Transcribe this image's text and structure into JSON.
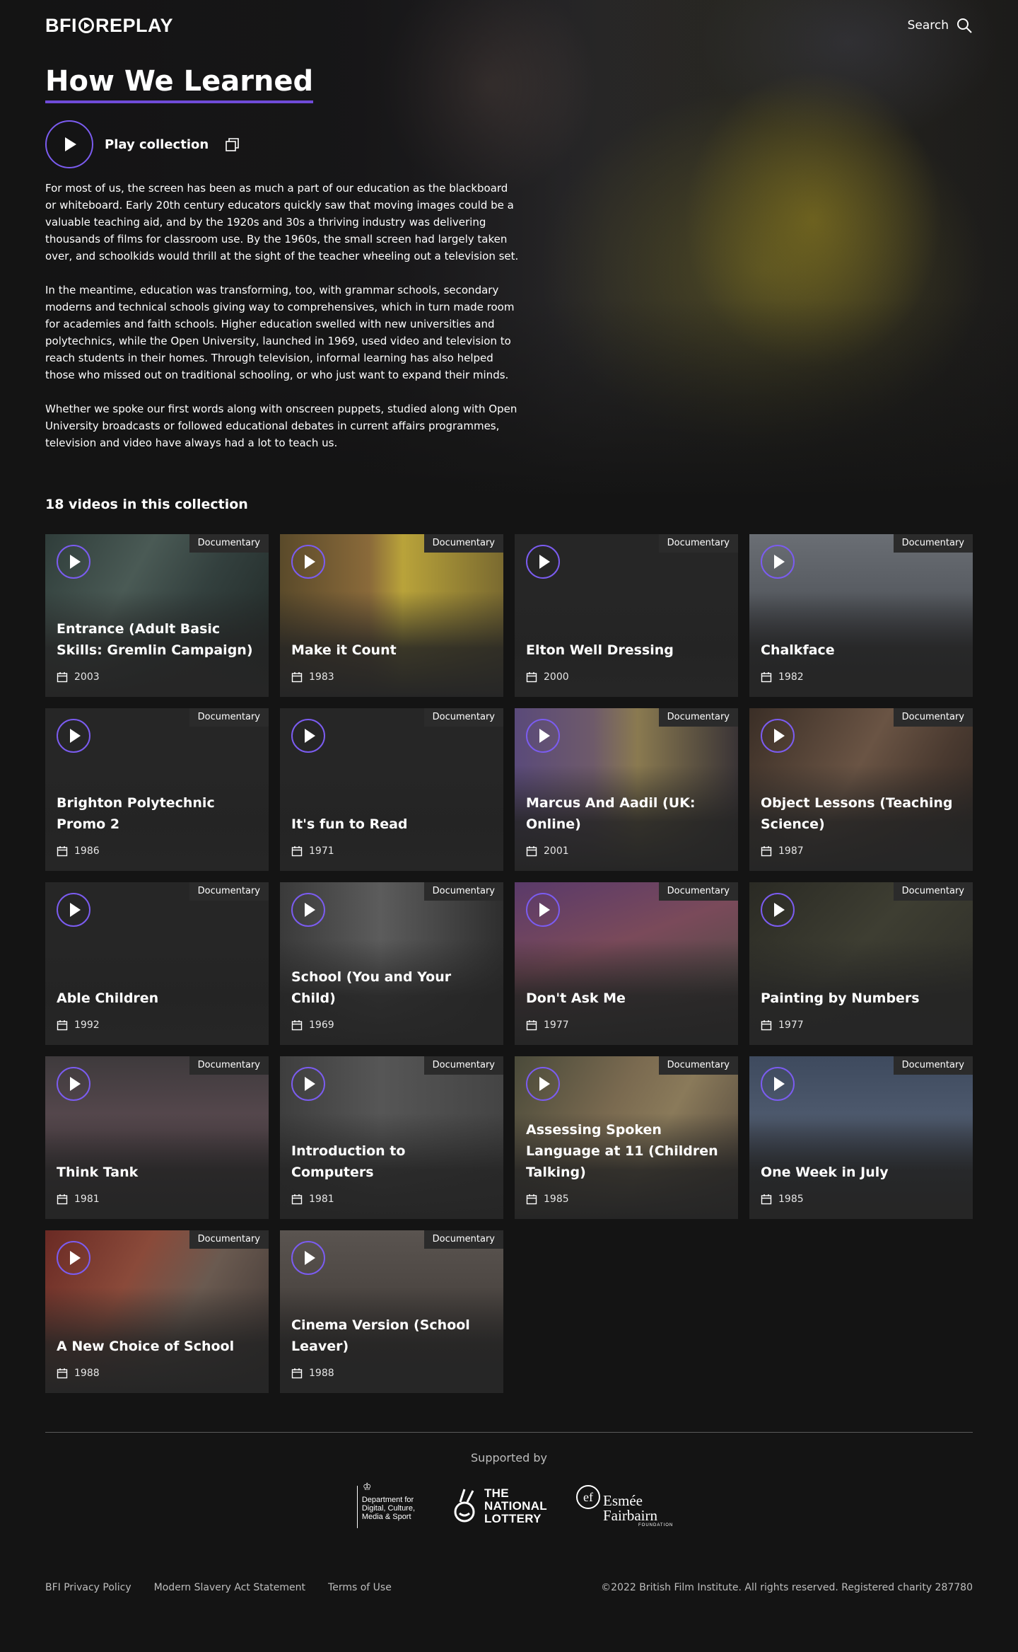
{
  "header": {
    "logo_left": "BFI",
    "logo_right": "REPLAY",
    "search_label": "Search"
  },
  "hero": {
    "title": "How We Learned",
    "play_label": "Play collection",
    "paragraphs": [
      "For most of us, the screen has been as much a part of our education as the blackboard or whiteboard. Early 20th century educators quickly saw that moving images could be a valuable teaching aid, and by the 1920s and 30s a thriving industry was delivering thousands of films for classroom use. By the 1960s, the small screen had largely taken over, and schoolkids would thrill at the sight of the teacher wheeling out a television set.",
      "In the meantime, education was transforming, too, with grammar schools, secondary moderns and technical schools giving way to comprehensives, which in turn made room for academies and faith schools. Higher education swelled with new universities and polytechnics, while the Open University, launched in 1969, used video and television to reach students in their homes. Through television, informal learning has also helped those who missed out on traditional schooling, or who just want to expand their minds.",
      "Whether we spoke our first words along with onscreen puppets, studied along with Open University broadcasts or followed educational debates in current affairs programmes, television and video have always had a lot to teach us."
    ]
  },
  "collection": {
    "count_label": "18 videos in this collection",
    "videos": [
      {
        "title": "Entrance (Adult Basic Skills: Gremlin Campaign)",
        "year": "2003",
        "badge": "Documentary",
        "bg": "linear-gradient(120deg,#2f3d3a 0%,#4a5a55 35%,#33403e 60%,#1e2523 100%)"
      },
      {
        "title": "Make it Count",
        "year": "1983",
        "badge": "Documentary",
        "bg": "linear-gradient(90deg,#5a4a2a 0%,#8a6a3a 40%,#b9a33a 55%,#7a6a30 100%)"
      },
      {
        "title": "Elton Well Dressing",
        "year": "2000",
        "badge": "Documentary",
        "bg": "#262626"
      },
      {
        "title": "Chalkface",
        "year": "1982",
        "badge": "Documentary",
        "bg": "linear-gradient(180deg,#6a6e74 0%,#565a60 40%,#3e4046 70%,#2a2a2c 100%)"
      },
      {
        "title": "Brighton Polytechnic Promo 2",
        "year": "1986",
        "badge": "Documentary",
        "bg": "#262626"
      },
      {
        "title": "It's fun to Read",
        "year": "1971",
        "badge": "Documentary",
        "bg": "#262626"
      },
      {
        "title": "Marcus And Aadil (UK: Online)",
        "year": "2001",
        "badge": "Documentary",
        "bg": "linear-gradient(90deg,#5a4a7a 0%,#6e5a6a 35%,#8a7a50 55%,#3a3436 100%)"
      },
      {
        "title": "Object Lessons (Teaching Science)",
        "year": "1987",
        "badge": "Documentary",
        "bg": "linear-gradient(120deg,#3a2e26 0%,#6a5444 45%,#4a3a30 70%,#2a2320 100%)"
      },
      {
        "title": "Able Children",
        "year": "1992",
        "badge": "Documentary",
        "bg": "#262626"
      },
      {
        "title": "School (You and Your Child)",
        "year": "1969",
        "badge": "Documentary",
        "bg": "linear-gradient(90deg,#3a3a3a 0%,#5c5c5c 45%,#484848 70%,#2e2e2e 100%)"
      },
      {
        "title": "Don't Ask Me",
        "year": "1977",
        "badge": "Documentary",
        "bg": "linear-gradient(160deg,#5a3a6a 0%,#7a4a5a 40%,#5a4a4a 70%,#3a3030 100%)"
      },
      {
        "title": "Painting by Numbers",
        "year": "1977",
        "badge": "Documentary",
        "bg": "linear-gradient(135deg,#2a2a24 0%,#3e3e32 45%,#2a2a26 100%)"
      },
      {
        "title": "Think Tank",
        "year": "1981",
        "badge": "Documentary",
        "bg": "linear-gradient(180deg,#3e3a3c 0%,#5a4a50 45%,#3a3236 100%)"
      },
      {
        "title": "Introduction to Computers",
        "year": "1981",
        "badge": "Documentary",
        "bg": "linear-gradient(90deg,#3e3e3e 0%,#565656 45%,#444444 100%)"
      },
      {
        "title": "Assessing Spoken Language at 11 (Children Talking)",
        "year": "1985",
        "badge": "Documentary",
        "bg": "linear-gradient(120deg,#4a4a3a 0%,#7a6a50 40%,#8a7a5a 60%,#4a4038 100%)"
      },
      {
        "title": "One Week in July",
        "year": "1985",
        "badge": "Documentary",
        "bg": "linear-gradient(180deg,#3e4a5e 0%,#4e5a6e 40%,#3a4250 70%,#2a2e34 100%)"
      },
      {
        "title": "A New Choice of School",
        "year": "1988",
        "badge": "Documentary",
        "bg": "linear-gradient(120deg,#6a2a24 0%,#8a4a3a 35%,#6a5a50 60%,#3a3230 100%)"
      },
      {
        "title": "Cinema Version (School Leaver)",
        "year": "1988",
        "badge": "Documentary",
        "bg": "linear-gradient(180deg,#5a5450 0%,#4a4440 45%,#2e2a28 100%)"
      }
    ]
  },
  "footer": {
    "supported_label": "Supported by",
    "sponsors": {
      "dcms": "Department for Digital, Culture, Media & Sport",
      "lottery": "THE NATIONAL LOTTERY",
      "esmee_line1": "Esmée",
      "esmee_line2": "Fairbairn",
      "esmee_found": "FOUNDATION"
    },
    "links": [
      "BFI Privacy Policy",
      "Modern Slavery Act Statement",
      "Terms of Use"
    ],
    "copyright": "©2022 British Film Institute. All rights reserved. Registered charity 287780"
  },
  "colors": {
    "accent": "#7b5cf0",
    "background": "#141414",
    "card": "#262626"
  }
}
